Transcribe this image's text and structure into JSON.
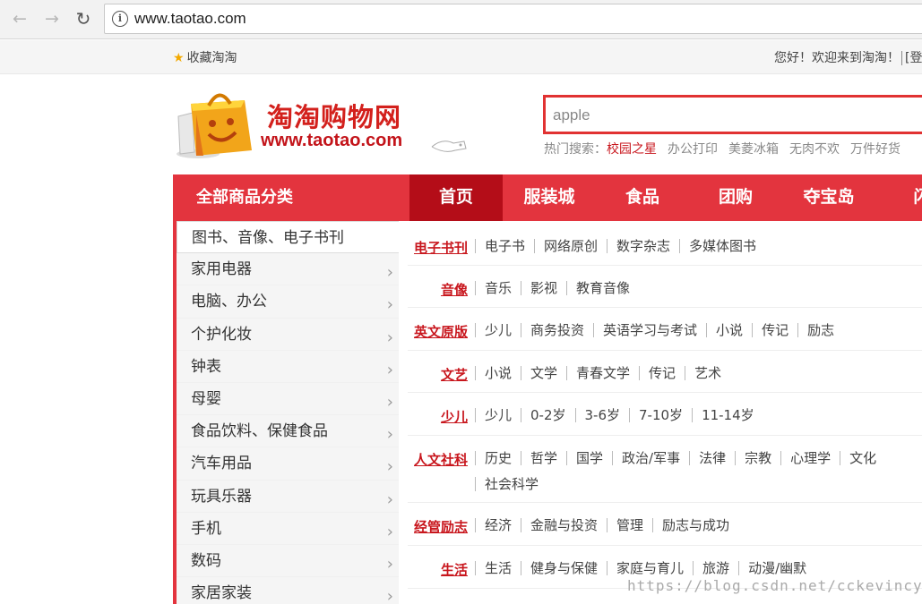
{
  "browser": {
    "url": "www.taotao.com",
    "back_icon": "←",
    "forward_icon": "→",
    "reload_icon": "↻",
    "info_icon": "i"
  },
  "topbar": {
    "favorite_icon": "★",
    "favorite": "收藏淘淘",
    "welcome": "您好！欢迎来到淘淘！",
    "login": "[登"
  },
  "logo": {
    "title": "淘淘购物网",
    "url": "www.taotao.com"
  },
  "search": {
    "value": "apple",
    "hot_label": "热门搜索：",
    "hot_keywords": [
      "校园之星",
      "办公打印",
      "美菱冰箱",
      "无肉不欢",
      "万件好货"
    ]
  },
  "nav": {
    "all_categories": "全部商品分类",
    "items": [
      "首页",
      "服装城",
      "食品",
      "团购",
      "夺宝岛",
      "闪"
    ]
  },
  "sidebar": {
    "arrow_icon": "›",
    "categories": [
      "图书、音像、电子书刊",
      "家用电器",
      "电脑、办公",
      "个护化妆",
      "钟表",
      "母婴",
      "食品饮料、保健食品",
      "汽车用品",
      "玩具乐器",
      "手机",
      "数码",
      "家居家装"
    ]
  },
  "content": {
    "rows": [
      {
        "label": "电子书刊",
        "items": [
          "电子书",
          "网络原创",
          "数字杂志",
          "多媒体图书"
        ]
      },
      {
        "label": "音像",
        "items": [
          "音乐",
          "影视",
          "教育音像"
        ]
      },
      {
        "label": "英文原版",
        "items": [
          "少儿",
          "商务投资",
          "英语学习与考试",
          "小说",
          "传记",
          "励志"
        ]
      },
      {
        "label": "文艺",
        "items": [
          "小说",
          "文学",
          "青春文学",
          "传记",
          "艺术"
        ]
      },
      {
        "label": "少儿",
        "items": [
          "少儿",
          "0-2岁",
          "3-6岁",
          "7-10岁",
          "11-14岁"
        ]
      },
      {
        "label": "人文社科",
        "items": [
          "历史",
          "哲学",
          "国学",
          "政治/军事",
          "法律",
          "宗教",
          "心理学",
          "文化",
          "社会科学"
        ]
      },
      {
        "label": "经管励志",
        "items": [
          "经济",
          "金融与投资",
          "管理",
          "励志与成功"
        ]
      },
      {
        "label": "生活",
        "items": [
          "生活",
          "健身与保健",
          "家庭与育儿",
          "旅游",
          "动漫/幽默"
        ]
      }
    ]
  },
  "watermark": "https://blog.csdn.net/cckevincyh"
}
